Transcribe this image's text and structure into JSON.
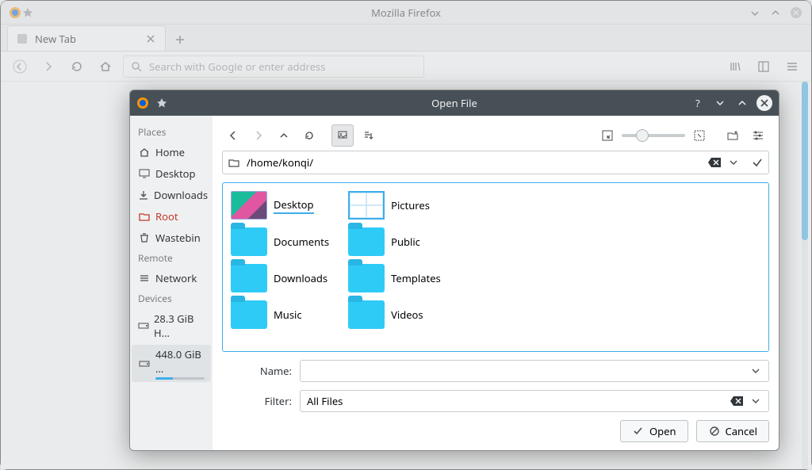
{
  "firefox": {
    "title": "Mozilla Firefox",
    "tab_label": "New Tab",
    "url_placeholder": "Search with Google or enter address"
  },
  "dialog": {
    "title": "Open File",
    "path": "/home/konqi/",
    "name_label": "Name:",
    "name_value": "",
    "filter_label": "Filter:",
    "filter_value": "All Files",
    "open_label": "Open",
    "cancel_label": "Cancel"
  },
  "sidebar": {
    "places_label": "Places",
    "remote_label": "Remote",
    "devices_label": "Devices",
    "items": [
      {
        "label": "Home"
      },
      {
        "label": "Desktop"
      },
      {
        "label": "Downloads"
      },
      {
        "label": "Root"
      },
      {
        "label": "Wastebin"
      }
    ],
    "remote": [
      {
        "label": "Network"
      }
    ],
    "devices": [
      {
        "label": "28.3 GiB H…"
      },
      {
        "label": "448.0 GiB …"
      }
    ]
  },
  "files": {
    "col1": [
      {
        "label": "Desktop",
        "kind": "desk"
      },
      {
        "label": "Documents",
        "kind": "folder"
      },
      {
        "label": "Downloads",
        "kind": "folder"
      },
      {
        "label": "Music",
        "kind": "folder"
      }
    ],
    "col2": [
      {
        "label": "Pictures",
        "kind": "pics"
      },
      {
        "label": "Public",
        "kind": "folder"
      },
      {
        "label": "Templates",
        "kind": "folder"
      },
      {
        "label": "Videos",
        "kind": "folder"
      }
    ]
  }
}
